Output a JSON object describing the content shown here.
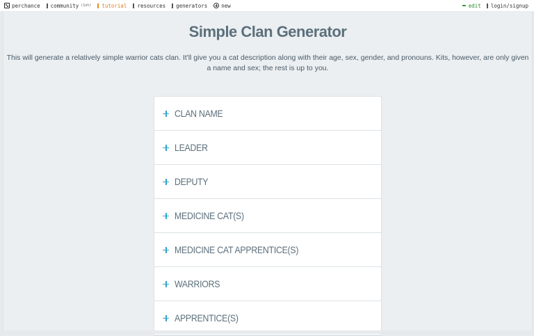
{
  "topbar": {
    "site": "perchance",
    "community": "community",
    "community_count": "(1oh)",
    "tutorial": "tutorial",
    "resources": "resources",
    "generators": "generators",
    "new": "new",
    "edit": "edit",
    "login": "login/signup"
  },
  "page": {
    "title": "Simple Clan Generator",
    "description": "This will generate a relatively simple warrior cats clan. It'll give you a cat description along with their age, sex, gender, and pronouns. Kits, however, are only given a name and sex; the rest is up to you."
  },
  "accordion": {
    "items": [
      {
        "label": "CLAN NAME"
      },
      {
        "label": "LEADER"
      },
      {
        "label": "DEPUTY"
      },
      {
        "label": "MEDICINE CAT(S)"
      },
      {
        "label": "MEDICINE CAT APPRENTICE(S)"
      },
      {
        "label": "WARRIORS"
      },
      {
        "label": "APPRENTICE(S)"
      }
    ]
  },
  "colors": {
    "accent": "#2fa3c9",
    "heading": "#5c6f7b",
    "tutorial": "#e07b1e",
    "edit": "#2e8b2e"
  }
}
